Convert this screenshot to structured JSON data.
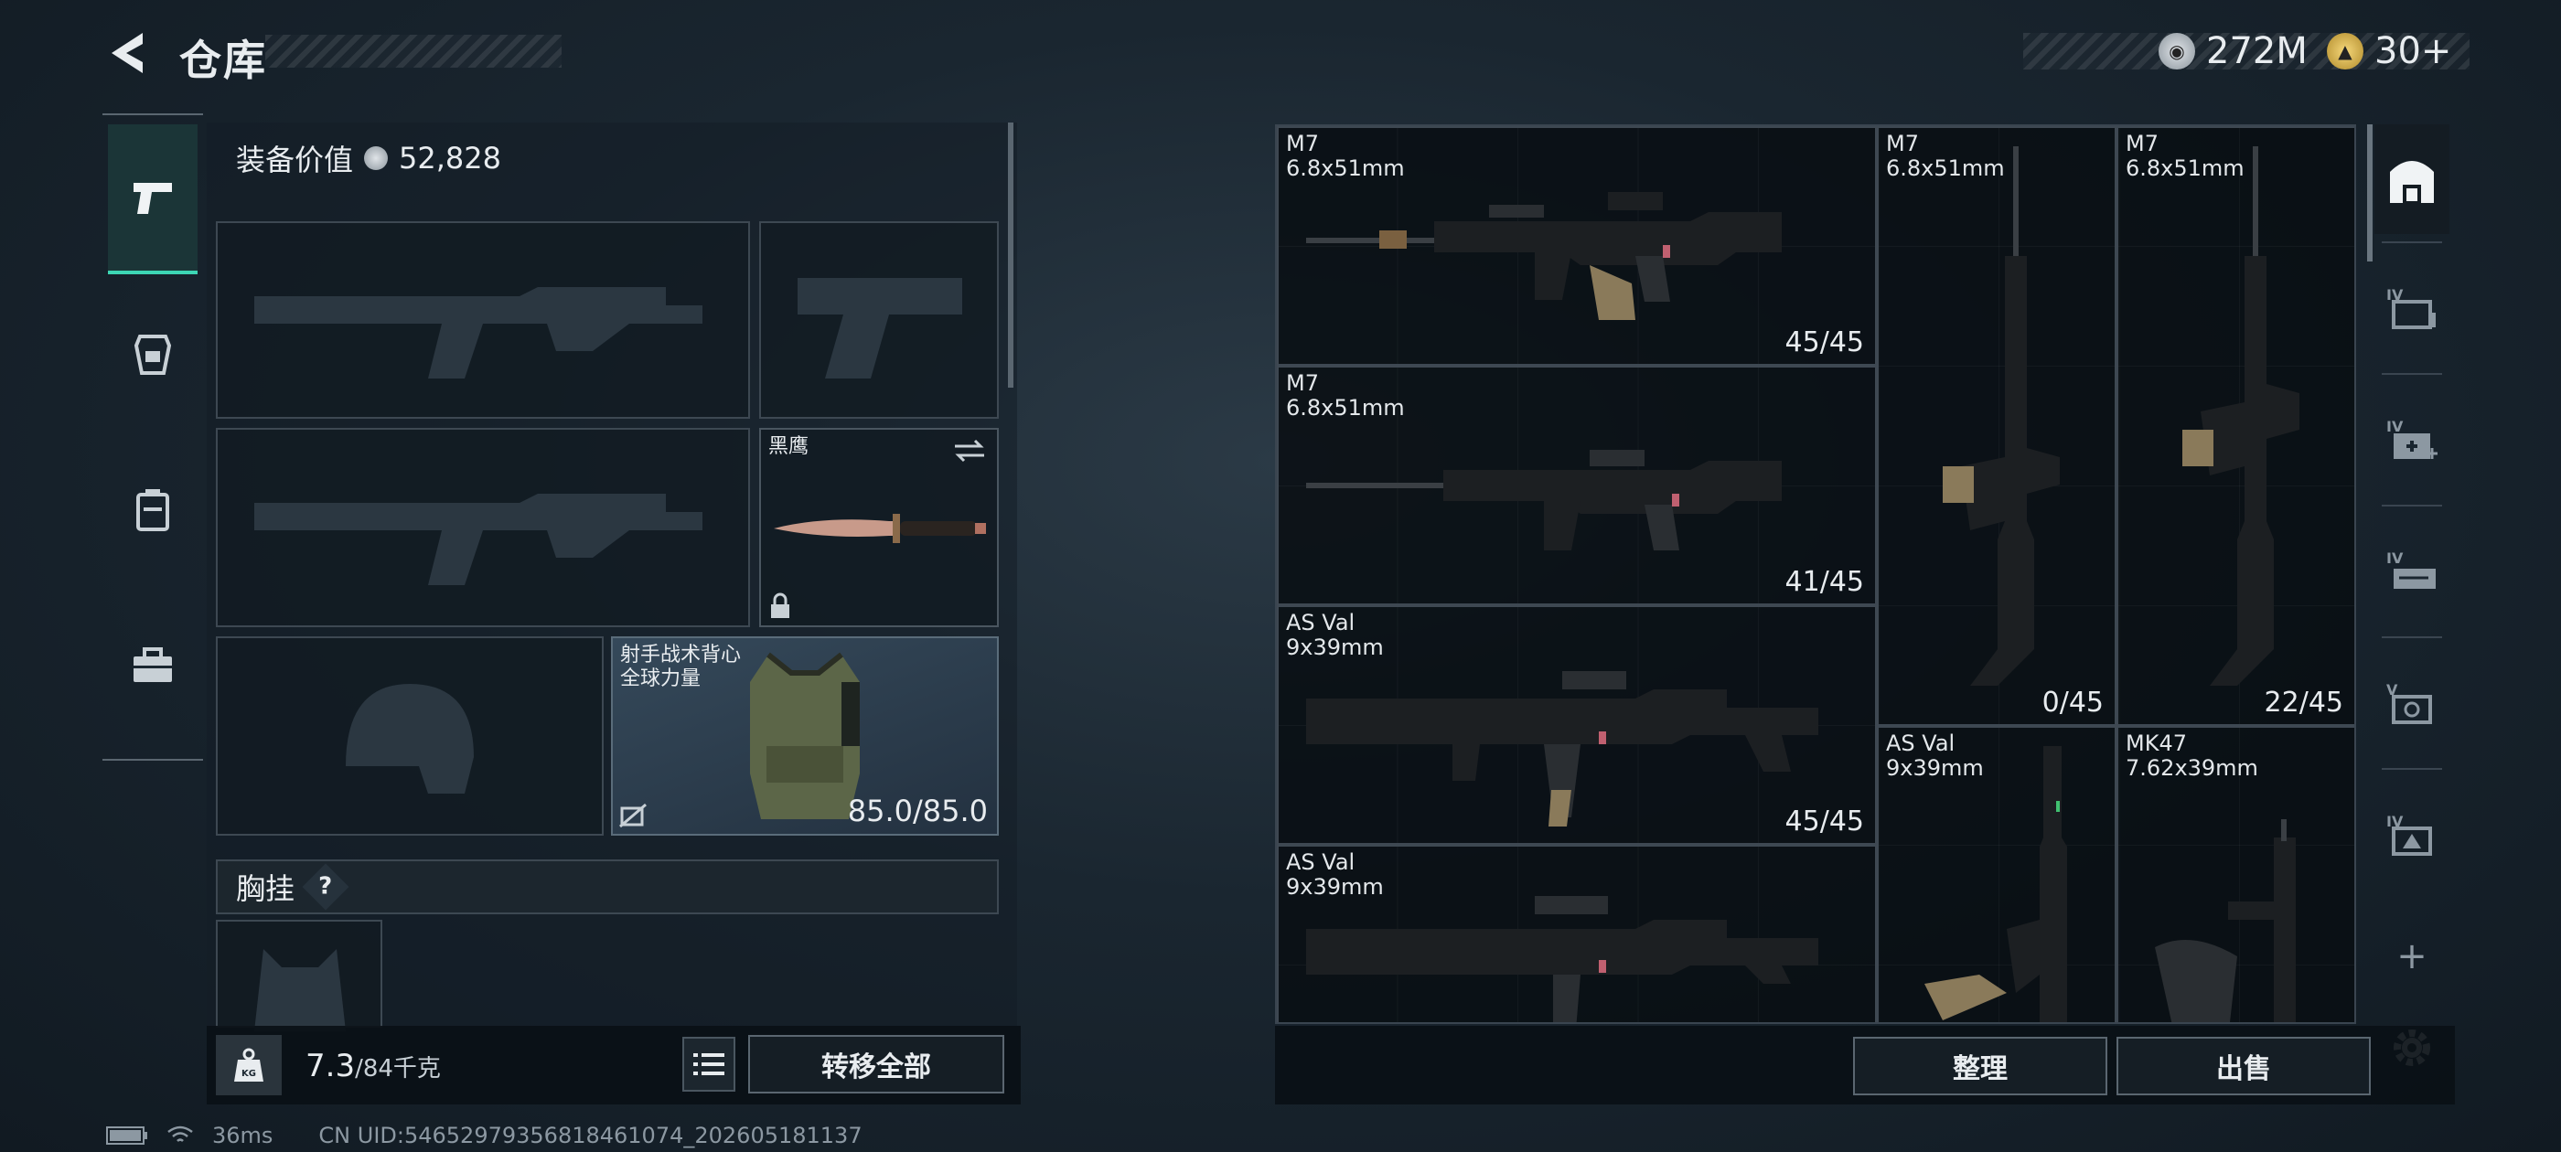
{
  "header": {
    "title": "仓库",
    "silver_amount": "272M",
    "gold_amount": "30+"
  },
  "side_tabs": [
    {
      "name": "firearms",
      "active": true
    },
    {
      "name": "armor"
    },
    {
      "name": "backpack"
    },
    {
      "name": "toolbox"
    }
  ],
  "equipment": {
    "value_label": "装备价值",
    "value_amount": "52,828",
    "melee_name": "黑鹰",
    "vest_name_line1": "射手战术背心",
    "vest_name_line2": "全球力量",
    "vest_durability": "85.0/85.0",
    "chest_rig_label": "胸挂",
    "chest_help": "?"
  },
  "capacity": {
    "current": "7.3",
    "max_unit": "/84千克"
  },
  "buttons": {
    "transfer_all": "转移全部",
    "sort": "整理",
    "sell": "出售"
  },
  "status": {
    "ping": "36ms",
    "uid": "CN UID:54652979356818461074_202605181137"
  },
  "stash_items": [
    {
      "name": "M7",
      "caliber": "6.8x51mm",
      "ammo": "45/45"
    },
    {
      "name": "M7",
      "caliber": "6.8x51mm",
      "ammo": "41/45"
    },
    {
      "name": "AS Val",
      "caliber": "9x39mm",
      "ammo": "45/45"
    },
    {
      "name": "AS Val",
      "caliber": "9x39mm",
      "ammo": ""
    },
    {
      "name": "M7",
      "caliber": "6.8x51mm",
      "ammo": "0/45"
    },
    {
      "name": "M7",
      "caliber": "6.8x51mm",
      "ammo": "22/45"
    },
    {
      "name": "AS Val",
      "caliber": "9x39mm",
      "ammo": ""
    },
    {
      "name": "MK47",
      "caliber": "7.62x39mm",
      "ammo": ""
    }
  ],
  "right_column": {
    "add_label": "+"
  },
  "colors": {
    "accent_teal": "#3dd6b4",
    "panel_dark": "#151e25"
  }
}
